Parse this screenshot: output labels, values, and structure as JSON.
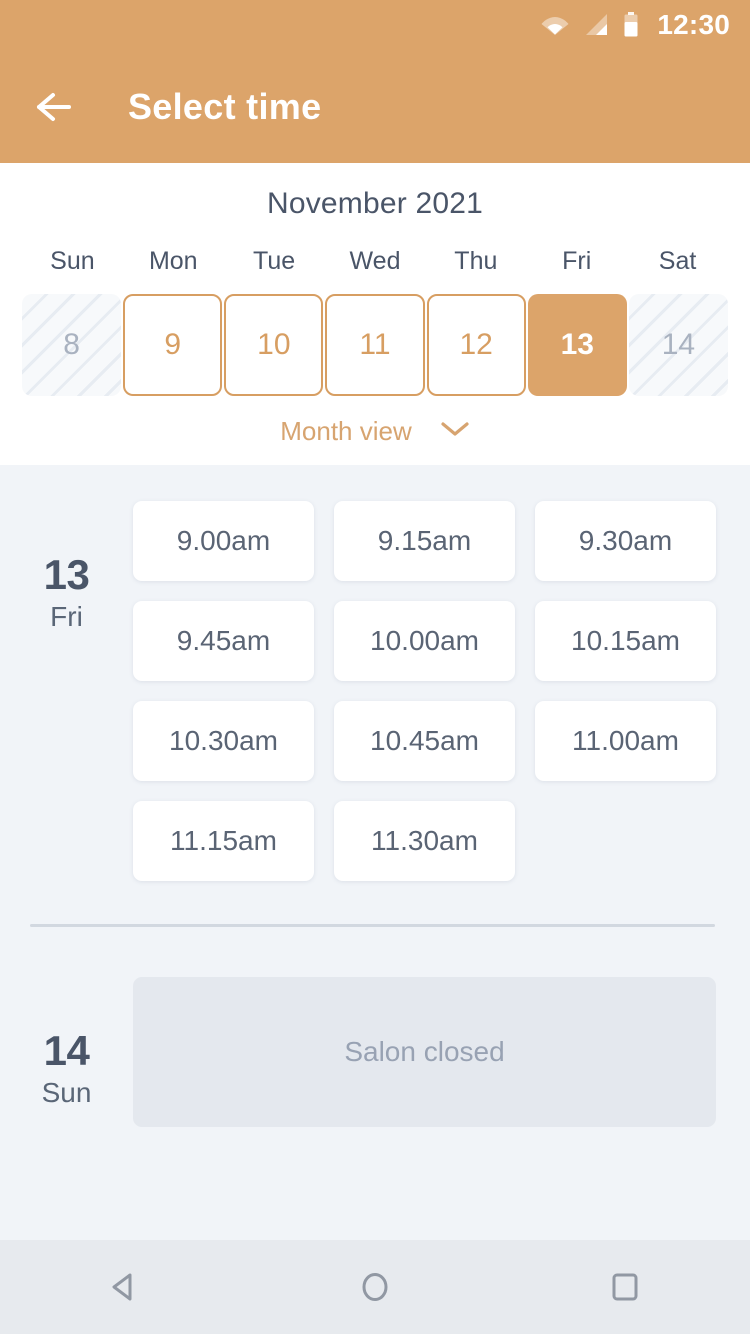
{
  "status_bar": {
    "time": "12:30",
    "icons": [
      "wifi-icon",
      "cellular-signal-icon",
      "battery-icon"
    ]
  },
  "app_bar": {
    "title": "Select time",
    "back_icon": "arrow-left-icon"
  },
  "calendar": {
    "month_label": "November 2021",
    "weekdays": [
      "Sun",
      "Mon",
      "Tue",
      "Wed",
      "Thu",
      "Fri",
      "Sat"
    ],
    "days": [
      {
        "number": "8",
        "state": "disabled"
      },
      {
        "number": "9",
        "state": "available"
      },
      {
        "number": "10",
        "state": "available"
      },
      {
        "number": "11",
        "state": "available"
      },
      {
        "number": "12",
        "state": "available"
      },
      {
        "number": "13",
        "state": "selected"
      },
      {
        "number": "14",
        "state": "disabled"
      }
    ],
    "view_toggle_label": "Month view",
    "view_toggle_icon": "chevron-down-icon"
  },
  "schedule": {
    "days": [
      {
        "day_number": "13",
        "day_name": "Fri",
        "slots": [
          "9.00am",
          "9.15am",
          "9.30am",
          "9.45am",
          "10.00am",
          "10.15am",
          "10.30am",
          "10.45am",
          "11.00am",
          "11.15am",
          "11.30am"
        ],
        "closed_message": null
      },
      {
        "day_number": "14",
        "day_name": "Sun",
        "slots": [],
        "closed_message": "Salon closed"
      }
    ]
  },
  "nav_bar": {
    "back_label": "back-triangle-icon",
    "home_label": "home-circle-icon",
    "recents_label": "recents-square-icon"
  },
  "colors": {
    "accent": "#DCA46A",
    "accent_border": "#D79E62",
    "page_bg": "#F1F4F8",
    "text_dark": "#4A5568",
    "text_muted": "#98A2B3"
  }
}
